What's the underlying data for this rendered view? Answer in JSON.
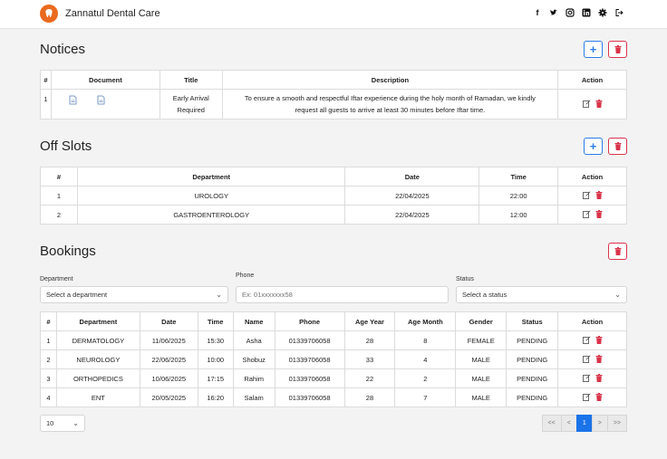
{
  "header": {
    "brand": "Zannatul Dental Care"
  },
  "colors": {
    "accent": "#2b7de9",
    "danger": "#d9344a",
    "logo": "#ea6a1f",
    "active_page": "#1a73e8"
  },
  "social_icons": [
    "facebook-icon",
    "twitter-icon",
    "instagram-icon",
    "linkedin-icon",
    "gear-icon",
    "logout-icon"
  ],
  "notices": {
    "title": "Notices",
    "headers": [
      "#",
      "Document",
      "Title",
      "Description",
      "Action"
    ],
    "rows": [
      {
        "num": "1",
        "title": "Early Arrival Required",
        "description": "To ensure a smooth and respectful Iftar experience during the holy month of Ramadan, we kindly request all guests to arrive at least 30 minutes before Iftar time."
      }
    ]
  },
  "off_slots": {
    "title": "Off Slots",
    "headers": [
      "#",
      "Department",
      "Date",
      "Time",
      "Action"
    ],
    "rows": [
      {
        "num": "1",
        "department": "UROLOGY",
        "date": "22/04/2025",
        "time": "22:00"
      },
      {
        "num": "2",
        "department": "GASTROENTEROLOGY",
        "date": "22/04/2025",
        "time": "12:00"
      }
    ]
  },
  "bookings": {
    "title": "Bookings",
    "filters": {
      "department_label": "Department",
      "department_value": "Select a department",
      "phone_label": "Phone",
      "phone_placeholder": "Ex: 01xxxxxxx58",
      "status_label": "Status",
      "status_value": "Select a status"
    },
    "headers": [
      "#",
      "Department",
      "Date",
      "Time",
      "Name",
      "Phone",
      "Age Year",
      "Age Month",
      "Gender",
      "Status",
      "Action"
    ],
    "rows": [
      {
        "num": "1",
        "department": "DERMATOLOGY",
        "date": "11/06/2025",
        "time": "15:30",
        "name": "Asha",
        "phone": "01339706058",
        "age_year": "28",
        "age_month": "8",
        "gender": "FEMALE",
        "status": "PENDING"
      },
      {
        "num": "2",
        "department": "NEUROLOGY",
        "date": "22/06/2025",
        "time": "10:00",
        "name": "Shobuz",
        "phone": "01339706058",
        "age_year": "33",
        "age_month": "4",
        "gender": "MALE",
        "status": "PENDING"
      },
      {
        "num": "3",
        "department": "ORTHOPEDICS",
        "date": "10/06/2025",
        "time": "17:15",
        "name": "Rahim",
        "phone": "01339706058",
        "age_year": "22",
        "age_month": "2",
        "gender": "MALE",
        "status": "PENDING"
      },
      {
        "num": "4",
        "department": "ENT",
        "date": "20/05/2025",
        "time": "16:20",
        "name": "Salam",
        "phone": "01339706058",
        "age_year": "28",
        "age_month": "7",
        "gender": "MALE",
        "status": "PENDING"
      }
    ]
  },
  "pagination": {
    "page_size": "10",
    "buttons": [
      "<<",
      "<",
      "1",
      ">",
      ">>"
    ],
    "active": "1"
  }
}
